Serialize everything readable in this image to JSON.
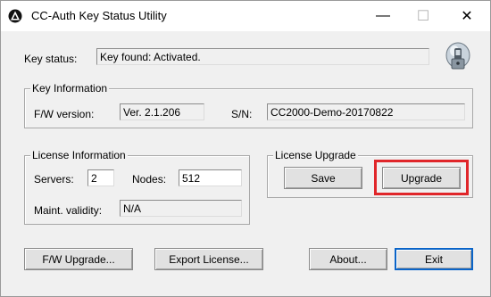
{
  "window": {
    "title": "CC-Auth Key Status Utility"
  },
  "titlebar": {
    "minimize": "—",
    "maximize": "☐",
    "close": "✕"
  },
  "key_status": {
    "label": "Key status:",
    "value": "Key found: Activated."
  },
  "key_info": {
    "group_title": "Key Information",
    "fw_label": "F/W version:",
    "fw_value": "Ver. 2.1.206",
    "sn_label": "S/N:",
    "sn_value": "CC2000-Demo-20170822"
  },
  "license_info": {
    "group_title": "License Information",
    "servers_label": "Servers:",
    "servers_value": "2",
    "nodes_label": "Nodes:",
    "nodes_value": "512",
    "maint_label": "Maint. validity:",
    "maint_value": "N/A"
  },
  "license_upgrade": {
    "group_title": "License Upgrade",
    "save_label": "Save",
    "upgrade_label": "Upgrade"
  },
  "bottom_buttons": {
    "fw_upgrade": "F/W Upgrade...",
    "export_license": "Export License...",
    "about": "About...",
    "exit": "Exit"
  },
  "icons": {
    "app": "app-logo-icon",
    "key": "usb-key-lock-icon"
  },
  "colors": {
    "highlight": "#e0262a",
    "window_bg": "#f0f0f0"
  }
}
